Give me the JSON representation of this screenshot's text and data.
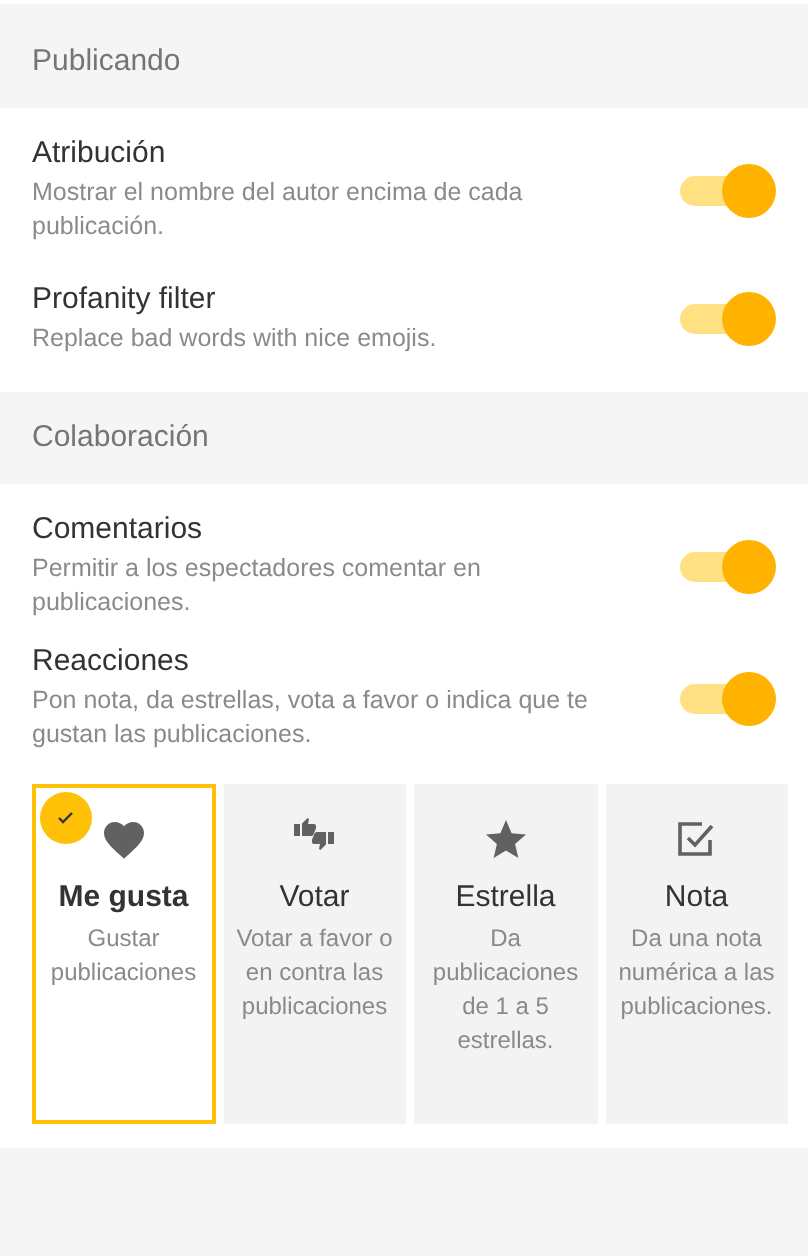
{
  "sections": [
    {
      "title": "Publicando",
      "settings": [
        {
          "title": "Atribución",
          "description": "Mostrar el nombre del autor encima de cada publicación.",
          "on": true
        },
        {
          "title": "Profanity filter",
          "description": "Replace bad words with nice emojis.",
          "on": true
        }
      ]
    },
    {
      "title": "Colaboración",
      "settings": [
        {
          "title": "Comentarios",
          "description": "Permitir a los espectadores comentar en publicaciones.",
          "on": true
        },
        {
          "title": "Reacciones",
          "description": "Pon nota, da estrellas, vota a favor o indica que te gustan las publicaciones.",
          "on": true
        }
      ],
      "reactions": [
        {
          "kind": "like",
          "label": "Me gusta",
          "description": "Gustar publicaciones",
          "selected": true
        },
        {
          "kind": "vote",
          "label": "Votar",
          "description": "Votar a favor o en contra las publicaciones",
          "selected": false
        },
        {
          "kind": "star",
          "label": "Estrella",
          "description": "Da publicaciones de 1 a 5 estrellas.",
          "selected": false
        },
        {
          "kind": "rate",
          "label": "Nota",
          "description": "Da una nota numérica a las publicaciones.",
          "selected": false
        }
      ]
    }
  ]
}
